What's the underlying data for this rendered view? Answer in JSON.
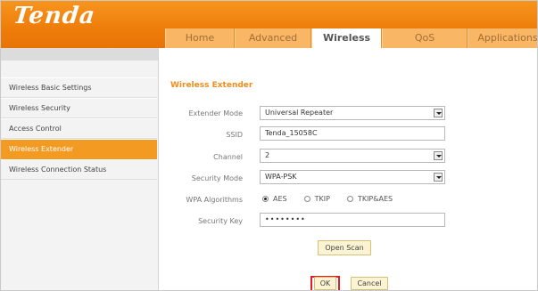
{
  "brand": {
    "logo_text": "Tenda"
  },
  "nav": {
    "tabs": [
      {
        "label": "Home",
        "active": false
      },
      {
        "label": "Advanced",
        "active": false
      },
      {
        "label": "Wireless",
        "active": true
      },
      {
        "label": "QoS",
        "active": false
      },
      {
        "label": "Applications",
        "active": false
      }
    ]
  },
  "sidebar": {
    "items": [
      {
        "label": "Wireless Basic Settings",
        "active": false
      },
      {
        "label": "Wireless Security",
        "active": false
      },
      {
        "label": "Access Control",
        "active": false
      },
      {
        "label": "Wireless Extender",
        "active": true
      },
      {
        "label": "Wireless Connection Status",
        "active": false
      }
    ]
  },
  "main": {
    "title": "Wireless Extender",
    "extender_mode": {
      "label": "Extender Mode",
      "value": "Universal Repeater"
    },
    "ssid": {
      "label": "SSID",
      "value": "Tenda_15058C"
    },
    "channel": {
      "label": "Channel",
      "value": "2"
    },
    "security_mode": {
      "label": "Security Mode",
      "value": "WPA-PSK"
    },
    "wpa_algorithms": {
      "label": "WPA Algorithms",
      "options": [
        {
          "label": "AES",
          "checked": true
        },
        {
          "label": "TKIP",
          "checked": false
        },
        {
          "label": "TKIP&AES",
          "checked": false
        }
      ]
    },
    "security_key": {
      "label": "Security Key",
      "value": "••••••••"
    },
    "open_scan_label": "Open Scan",
    "ok_label": "OK",
    "cancel_label": "Cancel"
  },
  "colors": {
    "brand_orange": "#f28c1a",
    "highlight_red": "#e02020"
  }
}
